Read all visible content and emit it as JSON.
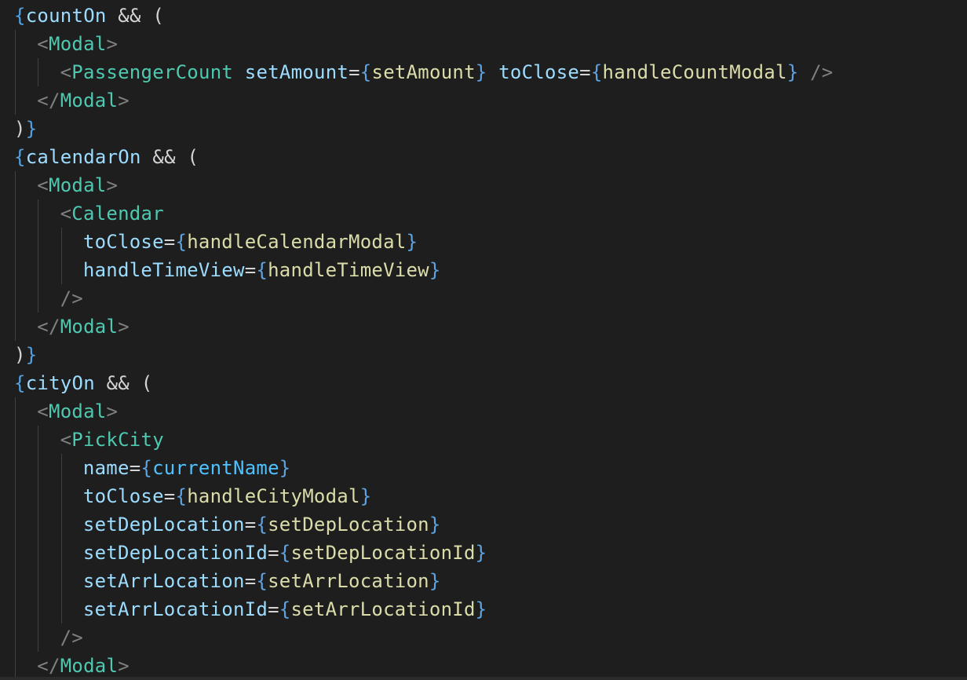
{
  "editor": {
    "lines": [
      {
        "indent": 0,
        "tokens": [
          {
            "t": "{",
            "c": "tok-brace-outer"
          },
          {
            "t": "countOn",
            "c": "tok-var"
          },
          {
            "t": " && ",
            "c": "tok-op"
          },
          {
            "t": "(",
            "c": "tok-paren"
          }
        ]
      },
      {
        "indent": 1,
        "tokens": [
          {
            "t": "<",
            "c": "tok-punc"
          },
          {
            "t": "Modal",
            "c": "tok-tag"
          },
          {
            "t": ">",
            "c": "tok-punc"
          }
        ]
      },
      {
        "indent": 2,
        "tokens": [
          {
            "t": "<",
            "c": "tok-punc"
          },
          {
            "t": "PassengerCount",
            "c": "tok-tag"
          },
          {
            "t": " ",
            "c": "tok-op"
          },
          {
            "t": "setAmount",
            "c": "tok-attr"
          },
          {
            "t": "=",
            "c": "tok-op"
          },
          {
            "t": "{",
            "c": "tok-brace-expr"
          },
          {
            "t": "setAmount",
            "c": "tok-func"
          },
          {
            "t": "}",
            "c": "tok-brace-expr"
          },
          {
            "t": " ",
            "c": "tok-op"
          },
          {
            "t": "toClose",
            "c": "tok-attr"
          },
          {
            "t": "=",
            "c": "tok-op"
          },
          {
            "t": "{",
            "c": "tok-brace-expr"
          },
          {
            "t": "handleCountModal",
            "c": "tok-func"
          },
          {
            "t": "}",
            "c": "tok-brace-expr"
          },
          {
            "t": " />",
            "c": "tok-punc"
          }
        ]
      },
      {
        "indent": 1,
        "tokens": [
          {
            "t": "</",
            "c": "tok-punc"
          },
          {
            "t": "Modal",
            "c": "tok-tag"
          },
          {
            "t": ">",
            "c": "tok-punc"
          }
        ]
      },
      {
        "indent": 0,
        "tokens": [
          {
            "t": ")",
            "c": "tok-paren"
          },
          {
            "t": "}",
            "c": "tok-brace-outer"
          }
        ]
      },
      {
        "indent": 0,
        "tokens": [
          {
            "t": "{",
            "c": "tok-brace-outer"
          },
          {
            "t": "calendarOn",
            "c": "tok-var"
          },
          {
            "t": " && ",
            "c": "tok-op"
          },
          {
            "t": "(",
            "c": "tok-paren"
          }
        ]
      },
      {
        "indent": 1,
        "tokens": [
          {
            "t": "<",
            "c": "tok-punc"
          },
          {
            "t": "Modal",
            "c": "tok-tag"
          },
          {
            "t": ">",
            "c": "tok-punc"
          }
        ]
      },
      {
        "indent": 2,
        "tokens": [
          {
            "t": "<",
            "c": "tok-punc"
          },
          {
            "t": "Calendar",
            "c": "tok-tag"
          }
        ]
      },
      {
        "indent": 3,
        "tokens": [
          {
            "t": "toClose",
            "c": "tok-attr"
          },
          {
            "t": "=",
            "c": "tok-op"
          },
          {
            "t": "{",
            "c": "tok-brace-expr"
          },
          {
            "t": "handleCalendarModal",
            "c": "tok-func"
          },
          {
            "t": "}",
            "c": "tok-brace-expr"
          }
        ]
      },
      {
        "indent": 3,
        "tokens": [
          {
            "t": "handleTimeView",
            "c": "tok-attr"
          },
          {
            "t": "=",
            "c": "tok-op"
          },
          {
            "t": "{",
            "c": "tok-brace-expr"
          },
          {
            "t": "handleTimeView",
            "c": "tok-func"
          },
          {
            "t": "}",
            "c": "tok-brace-expr"
          }
        ]
      },
      {
        "indent": 2,
        "tokens": [
          {
            "t": "/>",
            "c": "tok-punc"
          }
        ]
      },
      {
        "indent": 1,
        "tokens": [
          {
            "t": "</",
            "c": "tok-punc"
          },
          {
            "t": "Modal",
            "c": "tok-tag"
          },
          {
            "t": ">",
            "c": "tok-punc"
          }
        ]
      },
      {
        "indent": 0,
        "tokens": [
          {
            "t": ")",
            "c": "tok-paren"
          },
          {
            "t": "}",
            "c": "tok-brace-outer"
          }
        ]
      },
      {
        "indent": 0,
        "tokens": [
          {
            "t": "{",
            "c": "tok-brace-outer"
          },
          {
            "t": "cityOn",
            "c": "tok-var"
          },
          {
            "t": " && ",
            "c": "tok-op"
          },
          {
            "t": "(",
            "c": "tok-paren"
          }
        ]
      },
      {
        "indent": 1,
        "tokens": [
          {
            "t": "<",
            "c": "tok-punc"
          },
          {
            "t": "Modal",
            "c": "tok-tag"
          },
          {
            "t": ">",
            "c": "tok-punc"
          }
        ]
      },
      {
        "indent": 2,
        "tokens": [
          {
            "t": "<",
            "c": "tok-punc"
          },
          {
            "t": "PickCity",
            "c": "tok-tag"
          }
        ]
      },
      {
        "indent": 3,
        "tokens": [
          {
            "t": "name",
            "c": "tok-attr"
          },
          {
            "t": "=",
            "c": "tok-op"
          },
          {
            "t": "{",
            "c": "tok-brace-expr"
          },
          {
            "t": "currentName",
            "c": "tok-var-bright"
          },
          {
            "t": "}",
            "c": "tok-brace-expr"
          }
        ]
      },
      {
        "indent": 3,
        "tokens": [
          {
            "t": "toClose",
            "c": "tok-attr"
          },
          {
            "t": "=",
            "c": "tok-op"
          },
          {
            "t": "{",
            "c": "tok-brace-expr"
          },
          {
            "t": "handleCityModal",
            "c": "tok-func"
          },
          {
            "t": "}",
            "c": "tok-brace-expr"
          }
        ]
      },
      {
        "indent": 3,
        "tokens": [
          {
            "t": "setDepLocation",
            "c": "tok-attr"
          },
          {
            "t": "=",
            "c": "tok-op"
          },
          {
            "t": "{",
            "c": "tok-brace-expr"
          },
          {
            "t": "setDepLocation",
            "c": "tok-func"
          },
          {
            "t": "}",
            "c": "tok-brace-expr"
          }
        ]
      },
      {
        "indent": 3,
        "tokens": [
          {
            "t": "setDepLocationId",
            "c": "tok-attr"
          },
          {
            "t": "=",
            "c": "tok-op"
          },
          {
            "t": "{",
            "c": "tok-brace-expr"
          },
          {
            "t": "setDepLocationId",
            "c": "tok-func"
          },
          {
            "t": "}",
            "c": "tok-brace-expr"
          }
        ]
      },
      {
        "indent": 3,
        "tokens": [
          {
            "t": "setArrLocation",
            "c": "tok-attr"
          },
          {
            "t": "=",
            "c": "tok-op"
          },
          {
            "t": "{",
            "c": "tok-brace-expr"
          },
          {
            "t": "setArrLocation",
            "c": "tok-func"
          },
          {
            "t": "}",
            "c": "tok-brace-expr"
          }
        ]
      },
      {
        "indent": 3,
        "tokens": [
          {
            "t": "setArrLocationId",
            "c": "tok-attr"
          },
          {
            "t": "=",
            "c": "tok-op"
          },
          {
            "t": "{",
            "c": "tok-brace-expr"
          },
          {
            "t": "setArrLocationId",
            "c": "tok-func"
          },
          {
            "t": "}",
            "c": "tok-brace-expr"
          }
        ]
      },
      {
        "indent": 2,
        "tokens": [
          {
            "t": "/>",
            "c": "tok-punc"
          }
        ]
      },
      {
        "indent": 1,
        "tokens": [
          {
            "t": "</",
            "c": "tok-punc"
          },
          {
            "t": "Modal",
            "c": "tok-tag"
          },
          {
            "t": ">",
            "c": "tok-punc"
          }
        ]
      }
    ]
  },
  "theme": {
    "background": "#1e1e1e",
    "tag": "#4ec9b0",
    "attribute": "#9cdcfe",
    "function": "#dcdcaa",
    "punctuation": "#808080"
  }
}
